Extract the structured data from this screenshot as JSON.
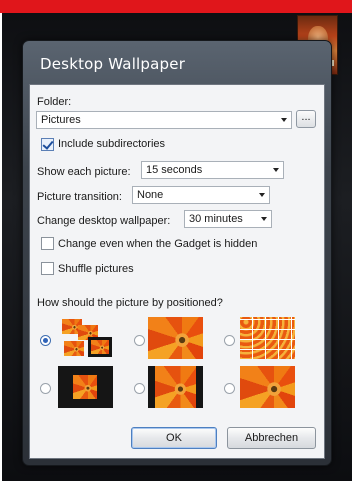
{
  "window": {
    "title": "Desktop Wallpaper"
  },
  "folder": {
    "label": "Folder:",
    "value": "Pictures",
    "browse_label": "..."
  },
  "include_subdirectories": {
    "label": "Include subdirectories",
    "checked": true
  },
  "show_each_picture": {
    "label": "Show each picture:",
    "value": "15 seconds"
  },
  "picture_transition": {
    "label": "Picture transition:",
    "value": "None"
  },
  "change_wallpaper": {
    "label": "Change desktop wallpaper:",
    "value": "30 minutes"
  },
  "change_when_hidden": {
    "label": "Change even when the Gadget is hidden",
    "checked": false
  },
  "shuffle": {
    "label": "Shuffle pictures",
    "checked": false
  },
  "position": {
    "question": "How should the picture by positioned?",
    "options": [
      {
        "name": "tile-scattered",
        "selected": true
      },
      {
        "name": "center",
        "selected": false
      },
      {
        "name": "tile",
        "selected": false
      },
      {
        "name": "center-black-frame",
        "selected": false
      },
      {
        "name": "fit-letterbox",
        "selected": false
      },
      {
        "name": "stretch",
        "selected": false
      }
    ]
  },
  "buttons": {
    "ok": "OK",
    "cancel": "Abbrechen"
  },
  "colors": {
    "accent_red": "#e0161b",
    "titlebar": "#3d444d"
  }
}
